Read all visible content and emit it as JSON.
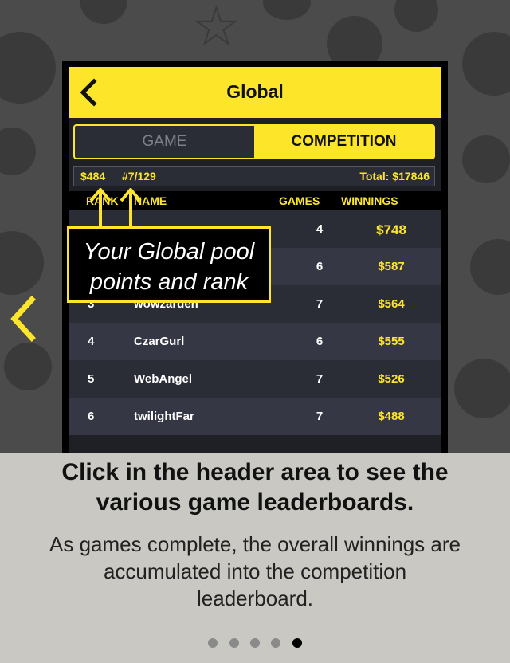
{
  "header": {
    "title": "Global"
  },
  "tabs": {
    "game_label": "GAME",
    "competition_label": "COMPETITION",
    "selected": "COMPETITION"
  },
  "stats": {
    "points": "$484",
    "rank": "#7/129",
    "total": "Total: $17846"
  },
  "table": {
    "columns": {
      "rank": "RANK",
      "name": "NAME",
      "games": "GAMES",
      "winnings": "WINNINGS"
    },
    "rows": [
      {
        "rank": "",
        "name": "",
        "games": "4",
        "winnings": "$748"
      },
      {
        "rank": "",
        "name": "",
        "games": "6",
        "winnings": "$587"
      },
      {
        "rank": "3",
        "name": "wowzarden",
        "games": "7",
        "winnings": "$564"
      },
      {
        "rank": "4",
        "name": "CzarGurl",
        "games": "6",
        "winnings": "$555"
      },
      {
        "rank": "5",
        "name": "WebAngel",
        "games": "7",
        "winnings": "$526"
      },
      {
        "rank": "6",
        "name": "twilightFar",
        "games": "7",
        "winnings": "$488"
      }
    ]
  },
  "callout": {
    "line1": "Your Global pool",
    "line2": "points and rank"
  },
  "caption": {
    "title_line1": "Click in the header area to see the",
    "title_line2": "various game leaderboards.",
    "body_line1": "As games complete, the overall winnings are",
    "body_line2": "accumulated into the competition",
    "body_line3": "leaderboard."
  },
  "pagination": {
    "total": 5,
    "active": 5
  },
  "colors": {
    "accent": "#fde62a",
    "background": "#4b4b4b",
    "caption_bg": "#c9c8c3",
    "row_dark": "#2a2c36",
    "row_light": "#353744"
  },
  "icons": {
    "back": "chevron-left-icon",
    "prev_slide": "chevron-left-icon"
  }
}
